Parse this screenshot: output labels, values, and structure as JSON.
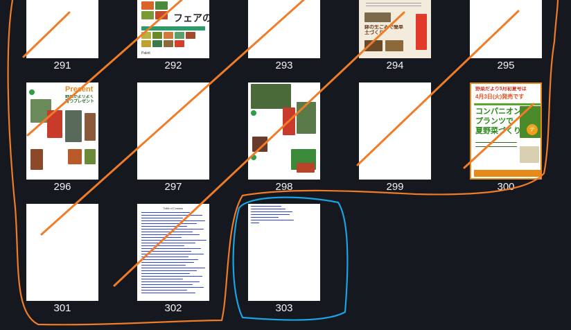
{
  "pages": [
    {
      "number": "291"
    },
    {
      "number": "292",
      "snippet": "フェアの",
      "footer": "Palett"
    },
    {
      "number": "293"
    },
    {
      "number": "294",
      "snippet": "鉢の生ごみで簡単土づくり"
    },
    {
      "number": "295"
    },
    {
      "number": "296",
      "headline": "Present",
      "sub": "野菜がよりよく育つプレゼント"
    },
    {
      "number": "297"
    },
    {
      "number": "298"
    },
    {
      "number": "299"
    },
    {
      "number": "300",
      "top": "野菜だより5月初夏号は",
      "date": "4月3日(火)発売です",
      "body1": "コンパニオン",
      "body2": "プランツで",
      "body3": "夏野菜づくり",
      "badge": "テ"
    },
    {
      "number": "301"
    },
    {
      "number": "302",
      "title": "Table of Contents"
    },
    {
      "number": "303"
    }
  ],
  "colors": {
    "background": "#15181e",
    "label": "#f2f2f2",
    "orange_annotation": "#f07c28",
    "blue_annotation": "#1aa3e6",
    "link_blue": "#2a3fd6"
  }
}
